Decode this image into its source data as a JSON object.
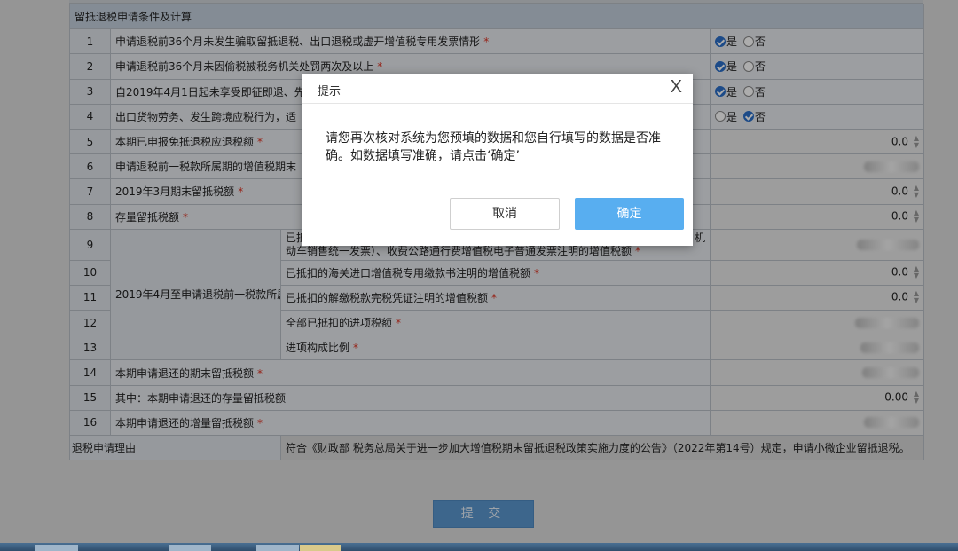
{
  "form": {
    "section_title": "留抵退税申请条件及计算",
    "yes_label": "是",
    "no_label": "否",
    "group_label": "2019年4月至申请退税前一税款所属期",
    "rows": [
      {
        "num": "1",
        "label": "申请退税前36个月未发生骗取留抵退税、出口退税或虚开增值税专用发票情形",
        "yes": true
      },
      {
        "num": "2",
        "label": "申请退税前36个月未因偷税被税务机关处罚两次及以上",
        "yes": true
      },
      {
        "num": "3",
        "label": "自2019年4月1日起未享受即征即退、先",
        "yes": true
      },
      {
        "num": "4",
        "label": "出口货物劳务、发生跨境应税行为，适",
        "yes": false
      },
      {
        "num": "5",
        "label": "本期已申报免抵退税应退税额",
        "value": "0.0"
      },
      {
        "num": "6",
        "label": "申请退税前一税款所属期的增值税期末"
      },
      {
        "num": "7",
        "label": "2019年3月期末留抵税额",
        "value": "0.0"
      },
      {
        "num": "8",
        "label": "存量留抵税额",
        "value": "0.0"
      },
      {
        "num": "9",
        "label_line1": "已抵",
        "label_line1_tail": "机",
        "label_line2": "动车销售统一发票）、收费公路通行费增值税电子普通发票注明的增值税额"
      },
      {
        "num": "10",
        "label": "已抵扣的海关进口增值税专用缴款书注明的增值税额",
        "value": "0.0"
      },
      {
        "num": "11",
        "label": "已抵扣的解缴税款完税凭证注明的增值税额",
        "value": "0.0"
      },
      {
        "num": "12",
        "label": "全部已抵扣的进项税额"
      },
      {
        "num": "13",
        "label": "进项构成比例"
      },
      {
        "num": "14",
        "label": "本期申请退还的期末留抵税额"
      },
      {
        "num": "15",
        "label": "其中：本期申请退还的存量留抵税额",
        "value": "0.00"
      },
      {
        "num": "16",
        "label": "本期申请退还的增量留抵税额"
      }
    ],
    "reason_label": "退税申请理由",
    "reason_text": "符合《财政部 税务总局关于进一步加大增值税期末留抵退税政策实施力度的公告》（2022年第14号）规定，申请小微企业留抵退税。",
    "submit_label": "提 交"
  },
  "dialog": {
    "title": "提示",
    "close": "X",
    "message": "请您再次核对系统为您预填的数据和您自行填写的数据是否准确。如数据填写准确，请点击‘确定’",
    "cancel_label": "取消",
    "ok_label": "确定"
  },
  "colors": {
    "section_bg": "#c3cfdc",
    "ok_button": "#58aef0",
    "submit_button": "#5b97cf",
    "required": "#d32"
  }
}
